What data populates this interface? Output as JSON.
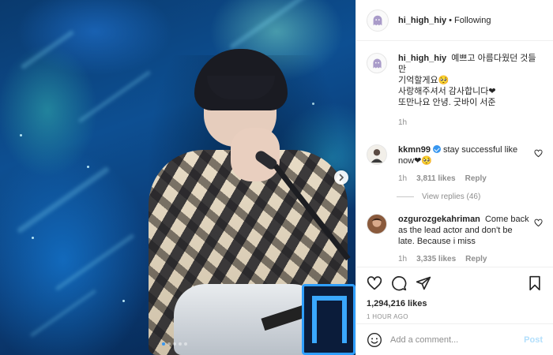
{
  "post": {
    "image_alt": "Concert photo",
    "carousel": {
      "count": 5,
      "active": 0
    }
  },
  "header": {
    "username": "hi_high_hiy",
    "separator": "•",
    "follow_status": "Following"
  },
  "caption": {
    "username": "hi_high_hiy",
    "text_line1": "예쁘고 아름다웠던 것들만",
    "text_line2": "기억할게요🥺",
    "text_line3": "사랑해주셔서 감사합니다❤",
    "text_line4": "또만나요 안녕. 굿바이 서준",
    "time": "1h"
  },
  "comments": [
    {
      "username": "kkmn99",
      "verified": true,
      "text": "stay successful like now❤🥺",
      "time": "1h",
      "likes": "3,811 likes",
      "reply": "Reply",
      "view_replies": "View replies (46)"
    },
    {
      "username": "ozgurozgekahriman",
      "verified": false,
      "text": "Come back as the lead actor and don't be late. Because i miss",
      "time": "1h",
      "likes": "3,335 likes",
      "reply": "Reply"
    }
  ],
  "actions": {
    "likes_count": "1,294,216 likes",
    "timestamp": "1 HOUR AGO"
  },
  "add_comment": {
    "placeholder": "Add a comment...",
    "post_label": "Post"
  },
  "colors": {
    "link_blue": "#3897f0",
    "post_disabled": "#b2dffc",
    "muted": "#8e8e8e"
  }
}
